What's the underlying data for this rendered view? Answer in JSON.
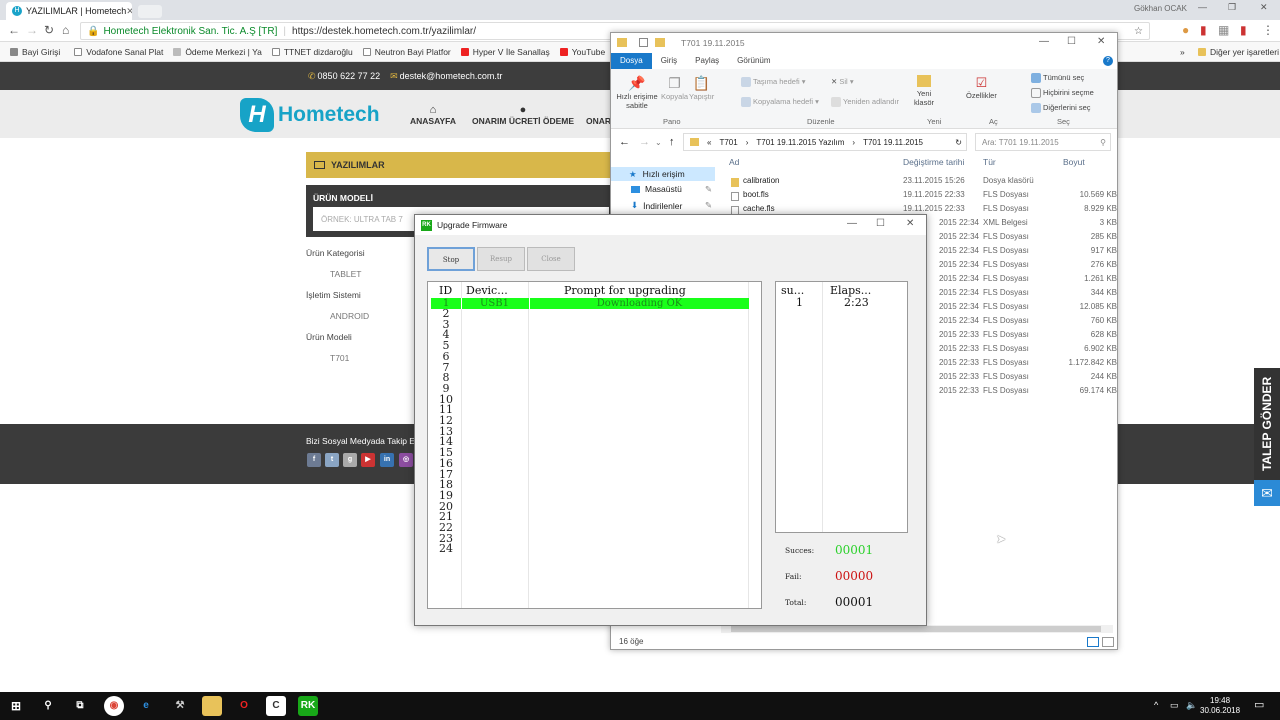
{
  "browser": {
    "tab_active": "YAZILIMLAR | Hometech",
    "url_site": "Hometech Elektronik San. Tic. A.Ş [TR]",
    "url": "https://destek.hometech.com.tr/yazilimlar/",
    "user": "Gökhan OCAK",
    "bookmarks": [
      "Bayi Girişi",
      "Vodafone Sanal Plat",
      "Ödeme Merkezi | Ya",
      "TTNET dizdaroğlu",
      "Neutron Bayi Platfor",
      "Hyper V İle Sanallaş",
      "YouTube"
    ],
    "bookmarks_other": "Diğer yer işaretleri"
  },
  "site": {
    "phone": "0850 622 77 22",
    "email": "destek@hometech.com.tr",
    "logo_text": "Hometech",
    "nav": [
      "ANASAYFA",
      "ONARIM ÜCRETİ ÖDEME",
      "ONAR"
    ],
    "section_title": "YAZILIMLAR",
    "model_label": "ÜRÜN MODELİ",
    "model_placeholder": "ÖRNEK: ULTRA TAB 7",
    "filters": [
      {
        "label": "Ürün Kategorisi",
        "value": "TABLET"
      },
      {
        "label": "İşletim Sistemi",
        "value": "ANDROID"
      },
      {
        "label": "Ürün Modeli",
        "value": "T701"
      }
    ],
    "footer_text": "Bizi Sosyal Medyada Takip E",
    "talep": "TALEP GÖNDER"
  },
  "explorer": {
    "title": "T701 19.11.2015",
    "tabs": [
      "Dosya",
      "Giriş",
      "Paylaş",
      "Görünüm"
    ],
    "ribbon": {
      "pin": "Hızlı erişime sabitle",
      "copy": "Kopyala",
      "paste": "Yapıştır",
      "move_to": "Taşıma hedefi",
      "copy_to": "Kopyalama hedefi",
      "delete": "Sil",
      "rename": "Yeniden adlandır",
      "new_folder": "Yeni klasör",
      "properties": "Özellikler",
      "select_all": "Tümünü seç",
      "select_none": "Hiçbirini seçme",
      "invert": "Diğerlerini seç",
      "groups": [
        "Pano",
        "Düzenle",
        "Yeni",
        "Aç",
        "Seç"
      ]
    },
    "path": [
      "«",
      "T701",
      "T701 19.11.2015 Yazılım",
      "T701 19.11.2015"
    ],
    "search_placeholder": "Ara: T701 19.11.2015",
    "nav": [
      "Hızlı erişim",
      "Masaüstü",
      "İndirilenler"
    ],
    "columns": [
      "Ad",
      "Değiştirme tarihi",
      "Tür",
      "Boyut"
    ],
    "files": [
      {
        "name": "calibration",
        "date": "23.11.2015 15:26",
        "type": "Dosya klasörü",
        "size": ""
      },
      {
        "name": "boot.fls",
        "date": "19.11.2015 22:33",
        "type": "FLS Dosyası",
        "size": "10.569 KB"
      },
      {
        "name": "cache.fls",
        "date": "19.11.2015 22:33",
        "type": "FLS Dosyası",
        "size": "8.929 KB"
      },
      {
        "name": "",
        "date": "2015 22:34",
        "type": "XML Belgesi",
        "size": "3 KB"
      },
      {
        "name": "",
        "date": "2015 22:34",
        "type": "FLS Dosyası",
        "size": "285 KB"
      },
      {
        "name": "",
        "date": "2015 22:34",
        "type": "FLS Dosyası",
        "size": "917 KB"
      },
      {
        "name": "",
        "date": "2015 22:34",
        "type": "FLS Dosyası",
        "size": "276 KB"
      },
      {
        "name": "",
        "date": "2015 22:34",
        "type": "FLS Dosyası",
        "size": "1.261 KB"
      },
      {
        "name": "",
        "date": "2015 22:34",
        "type": "FLS Dosyası",
        "size": "344 KB"
      },
      {
        "name": "",
        "date": "2015 22:34",
        "type": "FLS Dosyası",
        "size": "12.085 KB"
      },
      {
        "name": "",
        "date": "2015 22:34",
        "type": "FLS Dosyası",
        "size": "760 KB"
      },
      {
        "name": "",
        "date": "2015 22:33",
        "type": "FLS Dosyası",
        "size": "628 KB"
      },
      {
        "name": "",
        "date": "2015 22:33",
        "type": "FLS Dosyası",
        "size": "6.902 KB"
      },
      {
        "name": "",
        "date": "2015 22:33",
        "type": "FLS Dosyası",
        "size": "1.172.842 KB"
      },
      {
        "name": "",
        "date": "2015 22:33",
        "type": "FLS Dosyası",
        "size": "244 KB"
      },
      {
        "name": "",
        "date": "2015 22:33",
        "type": "FLS Dosyası",
        "size": "69.174 KB"
      }
    ],
    "status": "16 öğe"
  },
  "upgrade": {
    "title": "Upgrade Firmware",
    "buttons": [
      "Stop",
      "Resup",
      "Close"
    ],
    "columns": [
      "ID",
      "Devic...",
      "Prompt for upgrading"
    ],
    "row1": {
      "id": "1",
      "device": "USB1",
      "prompt": "Downloading OK"
    },
    "ids": [
      "2",
      "3",
      "4",
      "5",
      "6",
      "7",
      "8",
      "9",
      "10",
      "11",
      "12",
      "13",
      "14",
      "15",
      "16",
      "17",
      "18",
      "19",
      "20",
      "21",
      "22",
      "23",
      "24"
    ],
    "stat_columns": [
      "su...",
      "Elaps..."
    ],
    "stat_row": {
      "su": "1",
      "elapsed": "2:23"
    },
    "success_label": "Succes:",
    "success_value": "00001",
    "fail_label": "Fail:",
    "fail_value": "00000",
    "total_label": "Total:",
    "total_value": "00001",
    "colors": {
      "success": "#2ad12a",
      "fail": "#cc1111",
      "row": "#19ff19"
    }
  },
  "taskbar": {
    "time": "19:48",
    "date": "30.06.2018"
  }
}
